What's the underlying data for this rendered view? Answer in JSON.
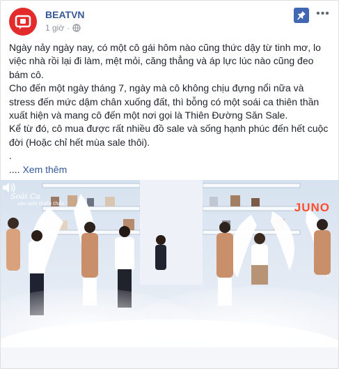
{
  "post": {
    "page_name": "BEATVN",
    "time": "1 giờ",
    "time_sep": "·",
    "paragraphs": [
      "Ngày nảy ngày nay, có một cô gái hôm nào cũng thức dậy từ tinh mơ, lo việc nhà rồi lại đi làm, mệt mỏi, căng thẳng và áp lực lúc nào cũng đeo bám cô.",
      "Cho đến một ngày tháng 7, ngày mà cô không chịu đựng nổi nữa và stress đến mức dậm chân xuống đất, thì bỗng có một soái ca thiên thần xuất hiện và mang cô đến một nơi gọi là Thiên Đường Săn Sale.",
      "Kể từ đó, cô mua được rất nhiều đồ sale và sống hạnh phúc đến hết cuộc đời (Hoặc chỉ hết mùa sale thôi).",
      "."
    ],
    "ellipsis": "....",
    "see_more": "Xem thêm",
    "more_dots": "•••"
  },
  "video": {
    "brand_overlay": "JUNO",
    "logo_line1": "Soái Ca",
    "logo_line2": "săn sale thiên thần"
  },
  "icons": {
    "avatar": "beatvn-logo-icon",
    "privacy": "globe-icon",
    "pin": "pin-icon",
    "more": "more-options-icon",
    "volume": "volume-icon"
  },
  "colors": {
    "link": "#365899",
    "brand_red": "#e32b2b",
    "pin_bg": "#4267b2",
    "juno": "#ff4d2e"
  }
}
